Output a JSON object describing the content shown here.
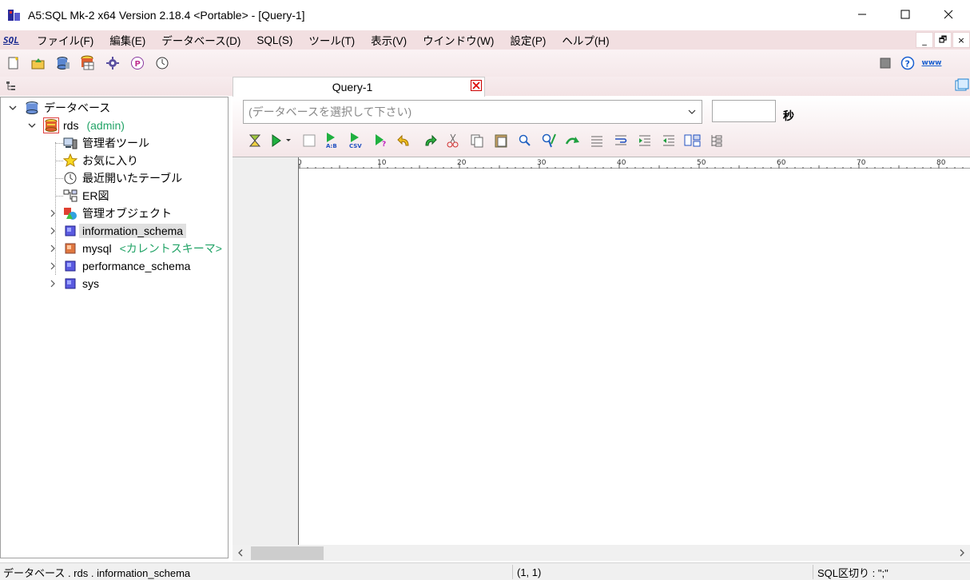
{
  "window": {
    "title": "A5:SQL Mk-2 x64 Version 2.18.4 <Portable> - [Query-1]",
    "min_glyph": "—",
    "max_glyph": "☐",
    "close_glyph": "✕"
  },
  "menu": {
    "items": [
      {
        "label": "ファイル(F)"
      },
      {
        "label": "編集(E)"
      },
      {
        "label": "データベース(D)"
      },
      {
        "label": "SQL(S)"
      },
      {
        "label": "ツール(T)"
      },
      {
        "label": "表示(V)"
      },
      {
        "label": "ウインドウ(W)"
      },
      {
        "label": "設定(P)"
      },
      {
        "label": "ヘルプ(H)"
      }
    ],
    "logo": "SQL",
    "mdi": {
      "minimize": "_",
      "restore": "🗗",
      "close": "×"
    }
  },
  "toolbar": {
    "www_label": "www",
    "help_glyph": "?"
  },
  "tree": {
    "root": "データベース",
    "connection": {
      "name": "rds",
      "user": "(admin)"
    },
    "children": [
      {
        "label": "管理者ツール"
      },
      {
        "label": "お気に入り"
      },
      {
        "label": "最近開いたテーブル"
      },
      {
        "label": "ER図"
      },
      {
        "label": "管理オブジェクト"
      }
    ],
    "schemas": [
      {
        "label": "information_schema",
        "selected": true
      },
      {
        "label": "mysql",
        "note": "<カレントスキーマ>"
      },
      {
        "label": "performance_schema"
      },
      {
        "label": "sys"
      }
    ]
  },
  "query": {
    "tab_label": "Query-1",
    "db_placeholder": "(データベースを選択して下さい)",
    "timeout_value": "",
    "seconds_label": "秒",
    "ab_label": "A:B",
    "csv_label": "CSV"
  },
  "ruler": {
    "labels": [
      "0",
      "10",
      "20",
      "30",
      "40",
      "50",
      "60",
      "70",
      "80"
    ]
  },
  "status": {
    "path": "データベース . rds . information_schema",
    "position": "(1, 1)",
    "delimiter": "SQL区切り : \";\""
  },
  "colors": {
    "accent_pink": "#f2dfe1",
    "current_schema_green": "#21a366",
    "tab_close_red": "#d00000"
  }
}
